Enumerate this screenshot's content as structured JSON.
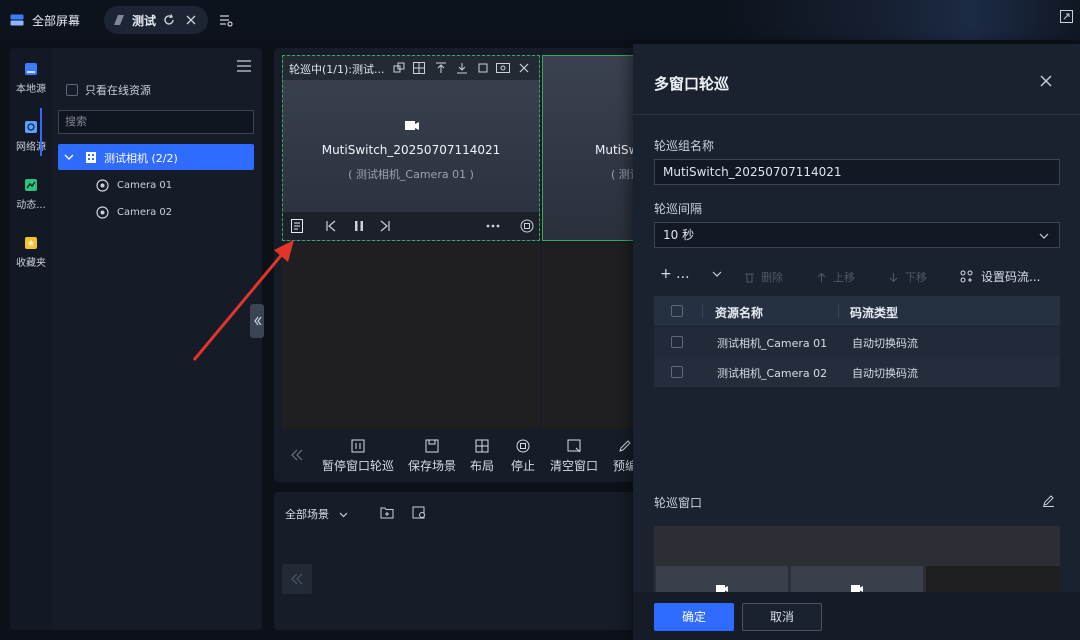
{
  "topbar": {
    "tab_all_label": "全部屏幕",
    "tab_test_label": "测试"
  },
  "rail": {
    "items": [
      {
        "label": "本地源",
        "color": "#3b7bff"
      },
      {
        "label": "网络源",
        "color": "#5aa0ff"
      },
      {
        "label": "动态...",
        "color": "#2ec27e"
      },
      {
        "label": "收藏夹",
        "color": "#f2c230"
      }
    ]
  },
  "resource": {
    "online_only_label": "只看在线资源",
    "search_placeholder": "搜索",
    "tree": {
      "root_label": "测试相机 (2/2)",
      "children": [
        "Camera 01",
        "Camera 02"
      ]
    }
  },
  "video": {
    "cell1_title": "轮巡中(1/1):测试...",
    "cell1_name": "MutiSwitch_20250707114021",
    "cell1_sub": "( 测试相机_Camera 01 )",
    "cell2_name": "MutiSw",
    "cell2_sub": "( 测试",
    "tools": [
      "暂停窗口轮巡",
      "保存场景",
      "布局",
      "停止",
      "清空窗口",
      "预编"
    ]
  },
  "scene": {
    "dropdown_label": "全部场景"
  },
  "dialog": {
    "title": "多窗口轮巡",
    "group_name_label": "轮巡组名称",
    "group_name_value": "MutiSwitch_20250707114021",
    "interval_label": "轮巡间隔",
    "interval_value": "10 秒",
    "toolbar": {
      "add": "+ ...",
      "delete": "删除",
      "up": "上移",
      "down": "下移",
      "stream": "设置码流..."
    },
    "table": {
      "col_name": "资源名称",
      "col_stream": "码流类型",
      "rows": [
        {
          "name": "测试相机_Camera 01",
          "stream": "自动切换码流"
        },
        {
          "name": "测试相机_Camera 02",
          "stream": "自动切换码流"
        }
      ]
    },
    "window_label": "轮巡窗口",
    "confirm_label": "确定",
    "cancel_label": "取消"
  },
  "colors": {
    "accent": "#2f6bff",
    "selection_border": "#3ea55b",
    "arrow": "#e0352b"
  }
}
